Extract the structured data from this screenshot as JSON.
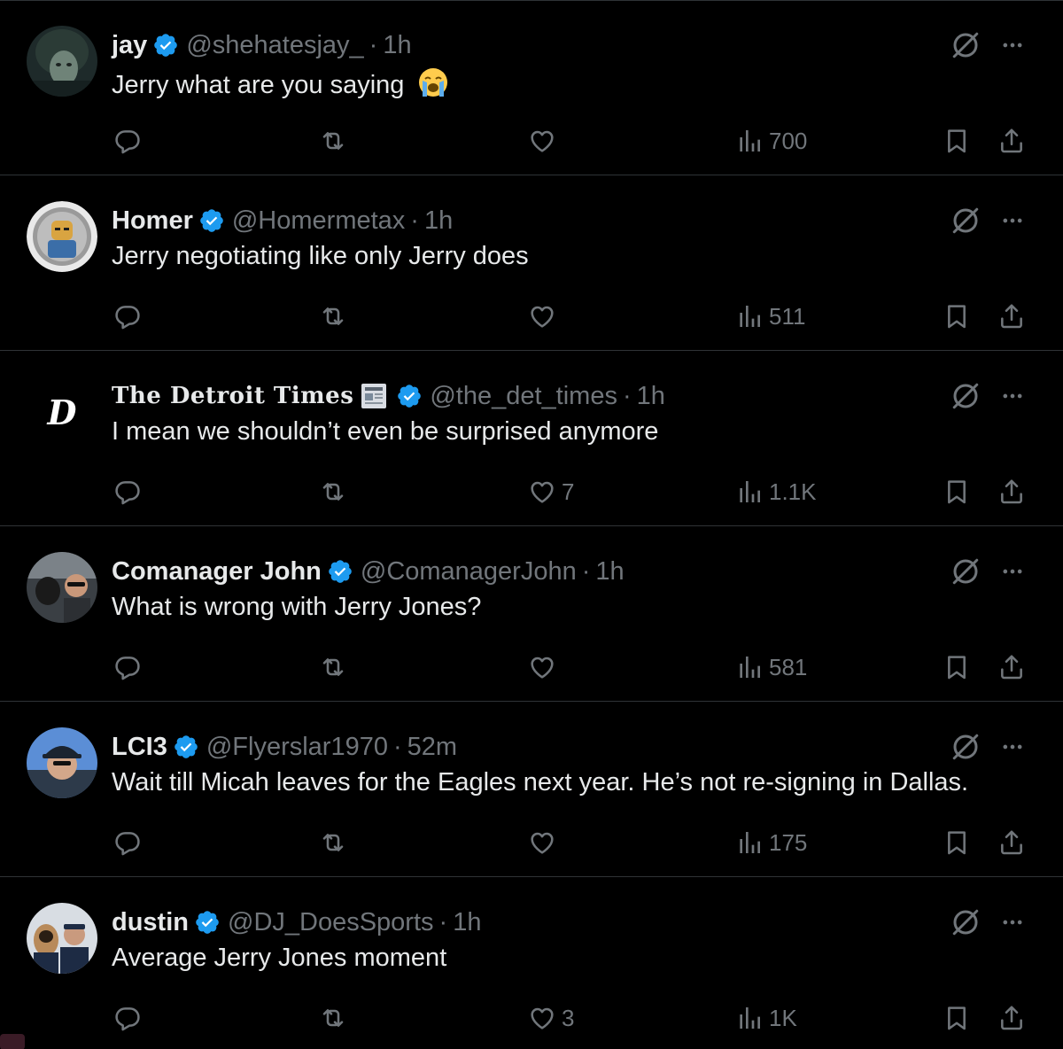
{
  "colors": {
    "background": "#000000",
    "text_primary": "#e7e9ea",
    "text_secondary": "#71767b",
    "divider": "#2f3336",
    "verified_badge": "#1d9bf0"
  },
  "tweets": [
    {
      "name": "jay",
      "handle": "@shehatesjay_",
      "separator": "·",
      "time": "1h",
      "text": "Jerry what are you saying",
      "emoji": "loudly-crying-face",
      "reply_count": "",
      "retweet_count": "",
      "like_count": "",
      "view_count": "700"
    },
    {
      "name": "Homer",
      "handle": "@Homermetax",
      "separator": "·",
      "time": "1h",
      "text": "Jerry negotiating like only Jerry does",
      "reply_count": "",
      "retweet_count": "",
      "like_count": "",
      "view_count": "511"
    },
    {
      "name": "The Detroit Times",
      "handle": "@the_det_times",
      "separator": "·",
      "time": "1h",
      "text": "I mean we shouldn’t even be surprised anymore",
      "avatar_letter": "D",
      "reply_count": "",
      "retweet_count": "",
      "like_count": "7",
      "view_count": "1.1K"
    },
    {
      "name": "Comanager John",
      "handle": "@ComanagerJohn",
      "separator": "·",
      "time": "1h",
      "text": "What is wrong with Jerry Jones?",
      "reply_count": "",
      "retweet_count": "",
      "like_count": "",
      "view_count": "581"
    },
    {
      "name": "LCI3",
      "handle": "@Flyerslar1970",
      "separator": "·",
      "time": "52m",
      "text": "Wait till Micah leaves for the Eagles next year. He’s not re-signing in Dallas.",
      "reply_count": "",
      "retweet_count": "",
      "like_count": "",
      "view_count": "175"
    },
    {
      "name": "dustin",
      "handle": "@DJ_DoesSports",
      "separator": "·",
      "time": "1h",
      "text": "Average Jerry Jones moment",
      "reply_count": "",
      "retweet_count": "",
      "like_count": "3",
      "view_count": "1K"
    }
  ]
}
